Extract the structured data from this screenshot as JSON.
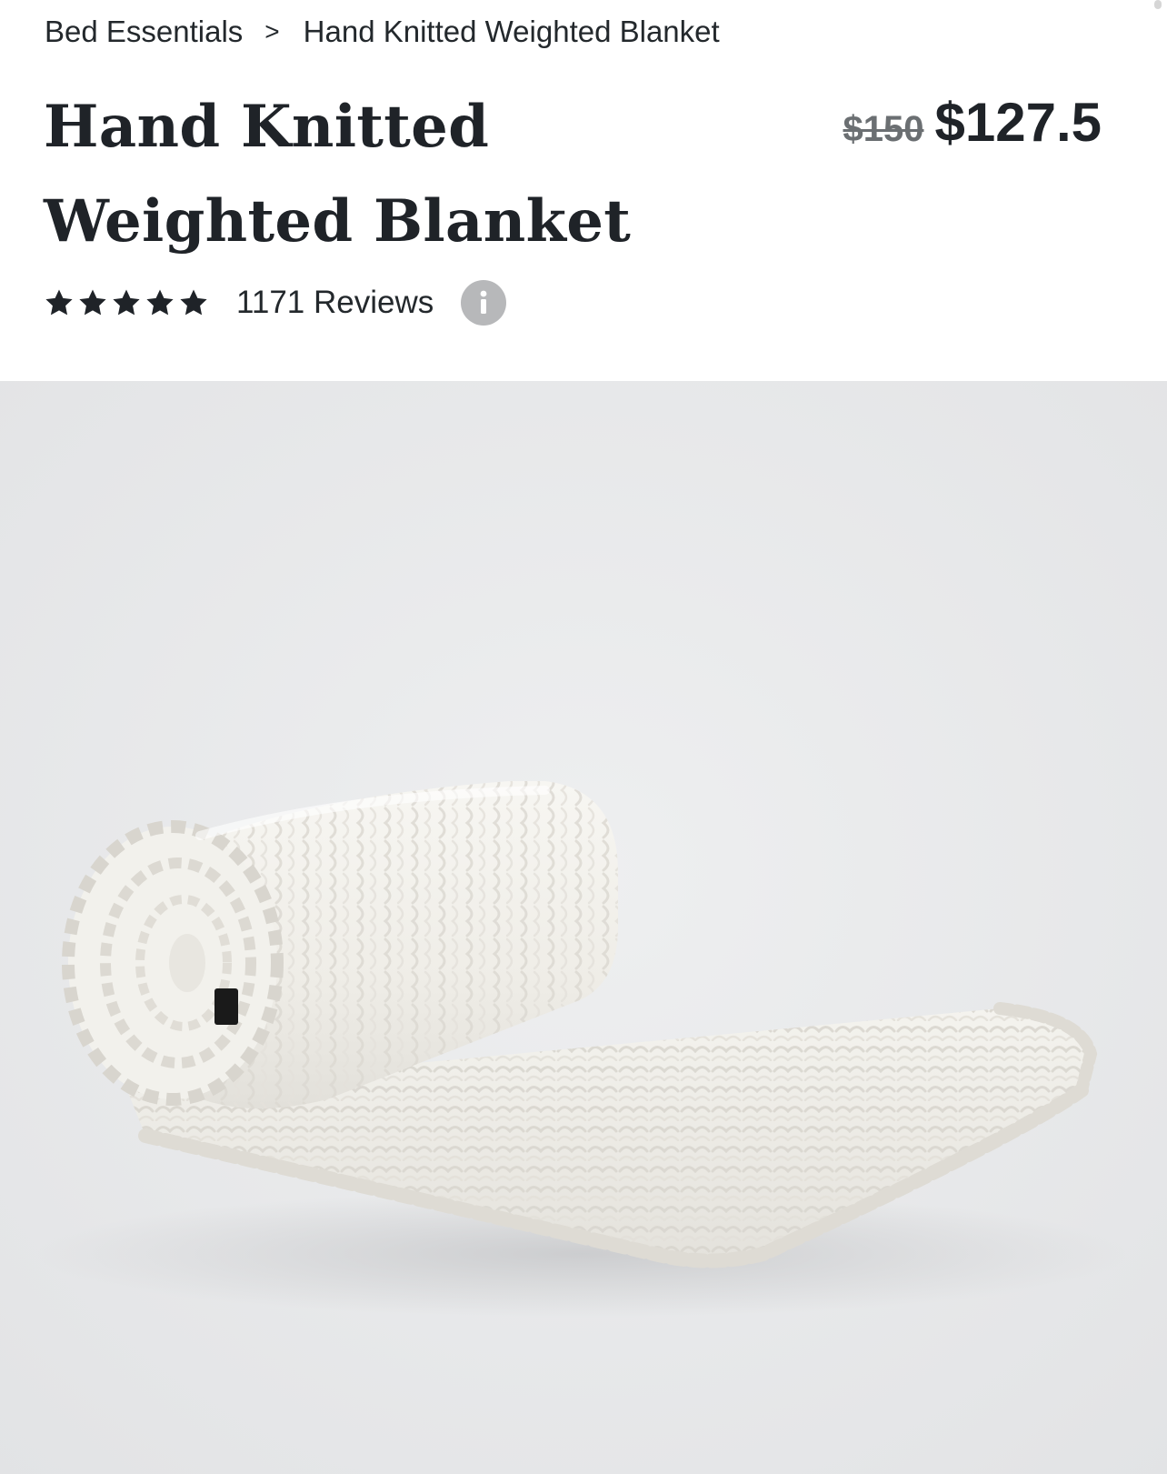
{
  "breadcrumb": {
    "items": [
      "Bed Essentials",
      "Hand Knitted Weighted Blanket"
    ],
    "separator": ">"
  },
  "product": {
    "title": "Hand Knitted Weighted Blanket",
    "price_original": "$150",
    "price_sale": "$127.5",
    "rating": 5,
    "rating_max": 5,
    "reviews_label": "1171 Reviews",
    "image": {
      "subject": "rolled white chunky knit blanket",
      "background_color": "#e7e8ea",
      "blanket_color": "#f4f3ef",
      "label_color": "#1a1a1a"
    }
  },
  "icons": {
    "star": "star-icon",
    "info": "info-icon"
  },
  "colors": {
    "text_primary": "#1f2328",
    "text_muted": "#6b6f72",
    "star": "#1f2328",
    "info_bg": "#b7b8ba"
  }
}
